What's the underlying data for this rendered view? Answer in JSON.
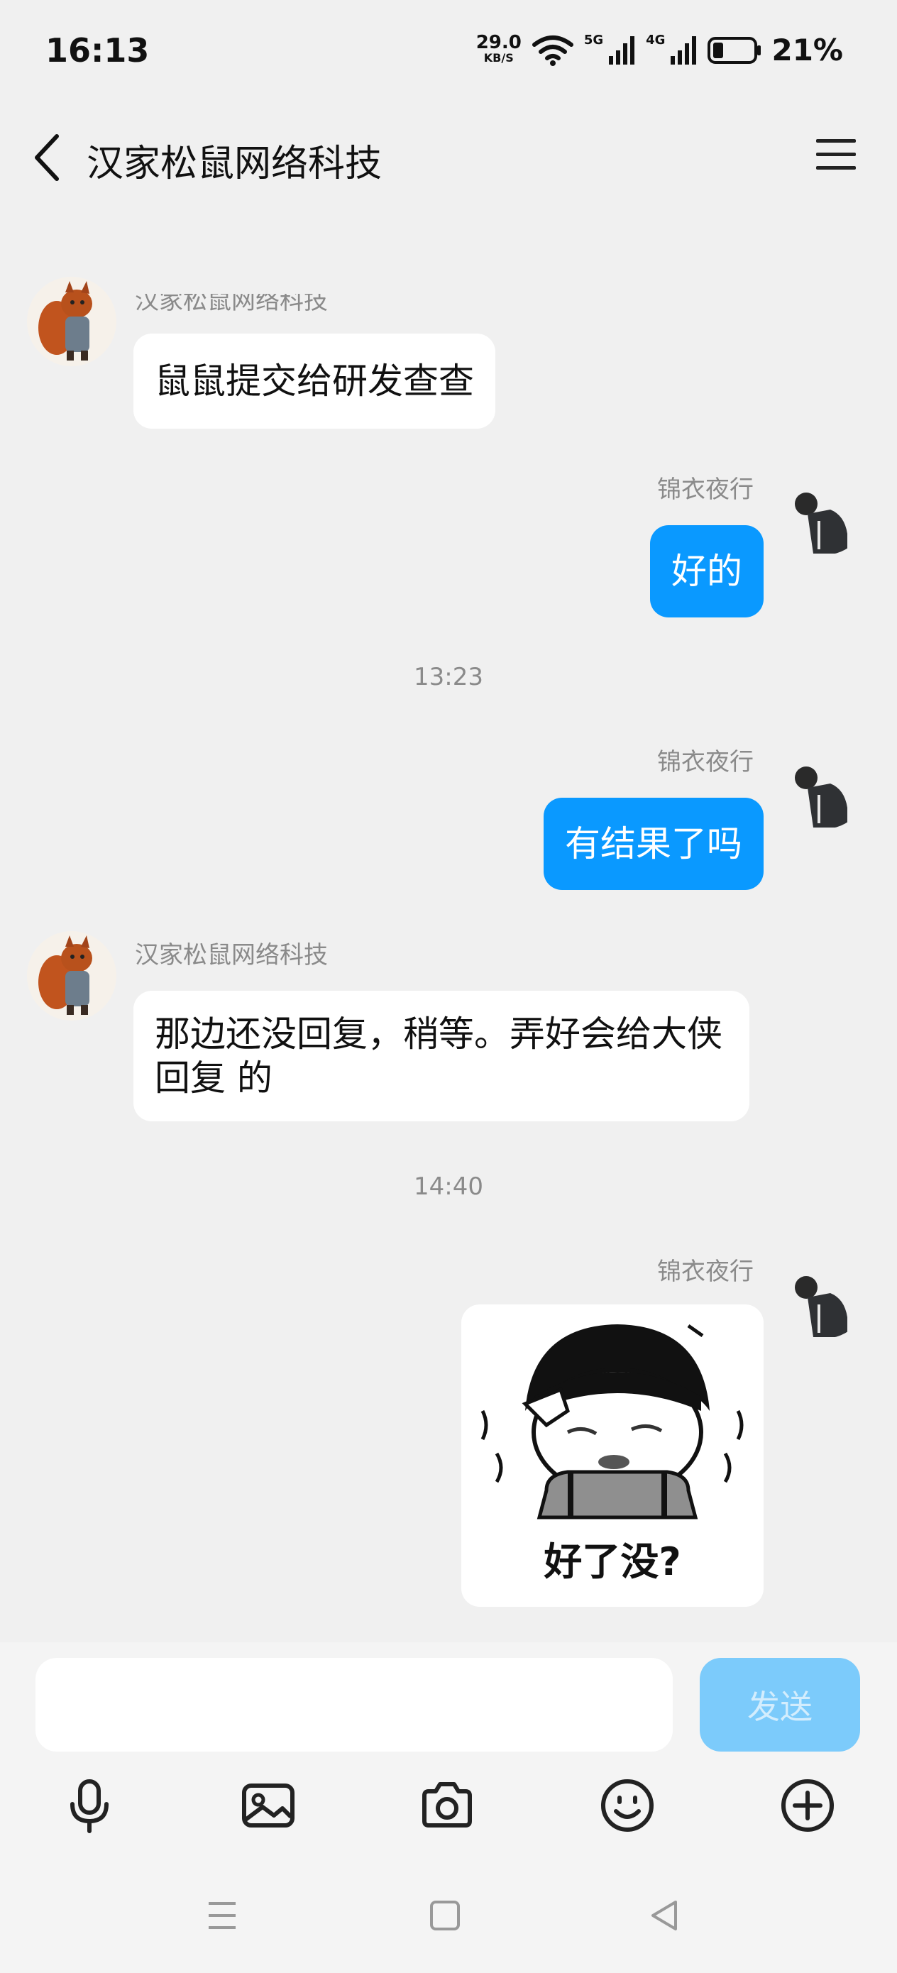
{
  "status_bar": {
    "time": "16:13",
    "net_speed": "29.0",
    "net_unit": "KB/S",
    "signal1_label": "5G",
    "signal2_label": "4G",
    "battery": "21%"
  },
  "header": {
    "title": "汉家松鼠网络科技"
  },
  "messages": [
    {
      "side": "left",
      "sender": "汉家松鼠网络科技",
      "text": "鼠鼠提交给研发查查"
    },
    {
      "side": "right",
      "sender": "锦衣夜行",
      "text": "好的"
    },
    {
      "time_divider": "13:23"
    },
    {
      "side": "right",
      "sender": "锦衣夜行",
      "text": "有结果了吗"
    },
    {
      "side": "left",
      "sender": "汉家松鼠网络科技",
      "text": "那边还没回复，稍等。弄好会给大侠回复 的"
    },
    {
      "time_divider": "14:40"
    },
    {
      "side": "right",
      "sender": "锦衣夜行",
      "sticker_text": "好了没?"
    }
  ],
  "input": {
    "value": "",
    "placeholder": "",
    "send_label": "发送"
  },
  "toolbar": [
    "microphone-icon",
    "image-icon",
    "camera-icon",
    "emoji-icon",
    "plus-icon"
  ],
  "colors": {
    "accent": "#0a99ff",
    "send_disabled": "#7ccbfb",
    "background": "#f0f0f0"
  }
}
